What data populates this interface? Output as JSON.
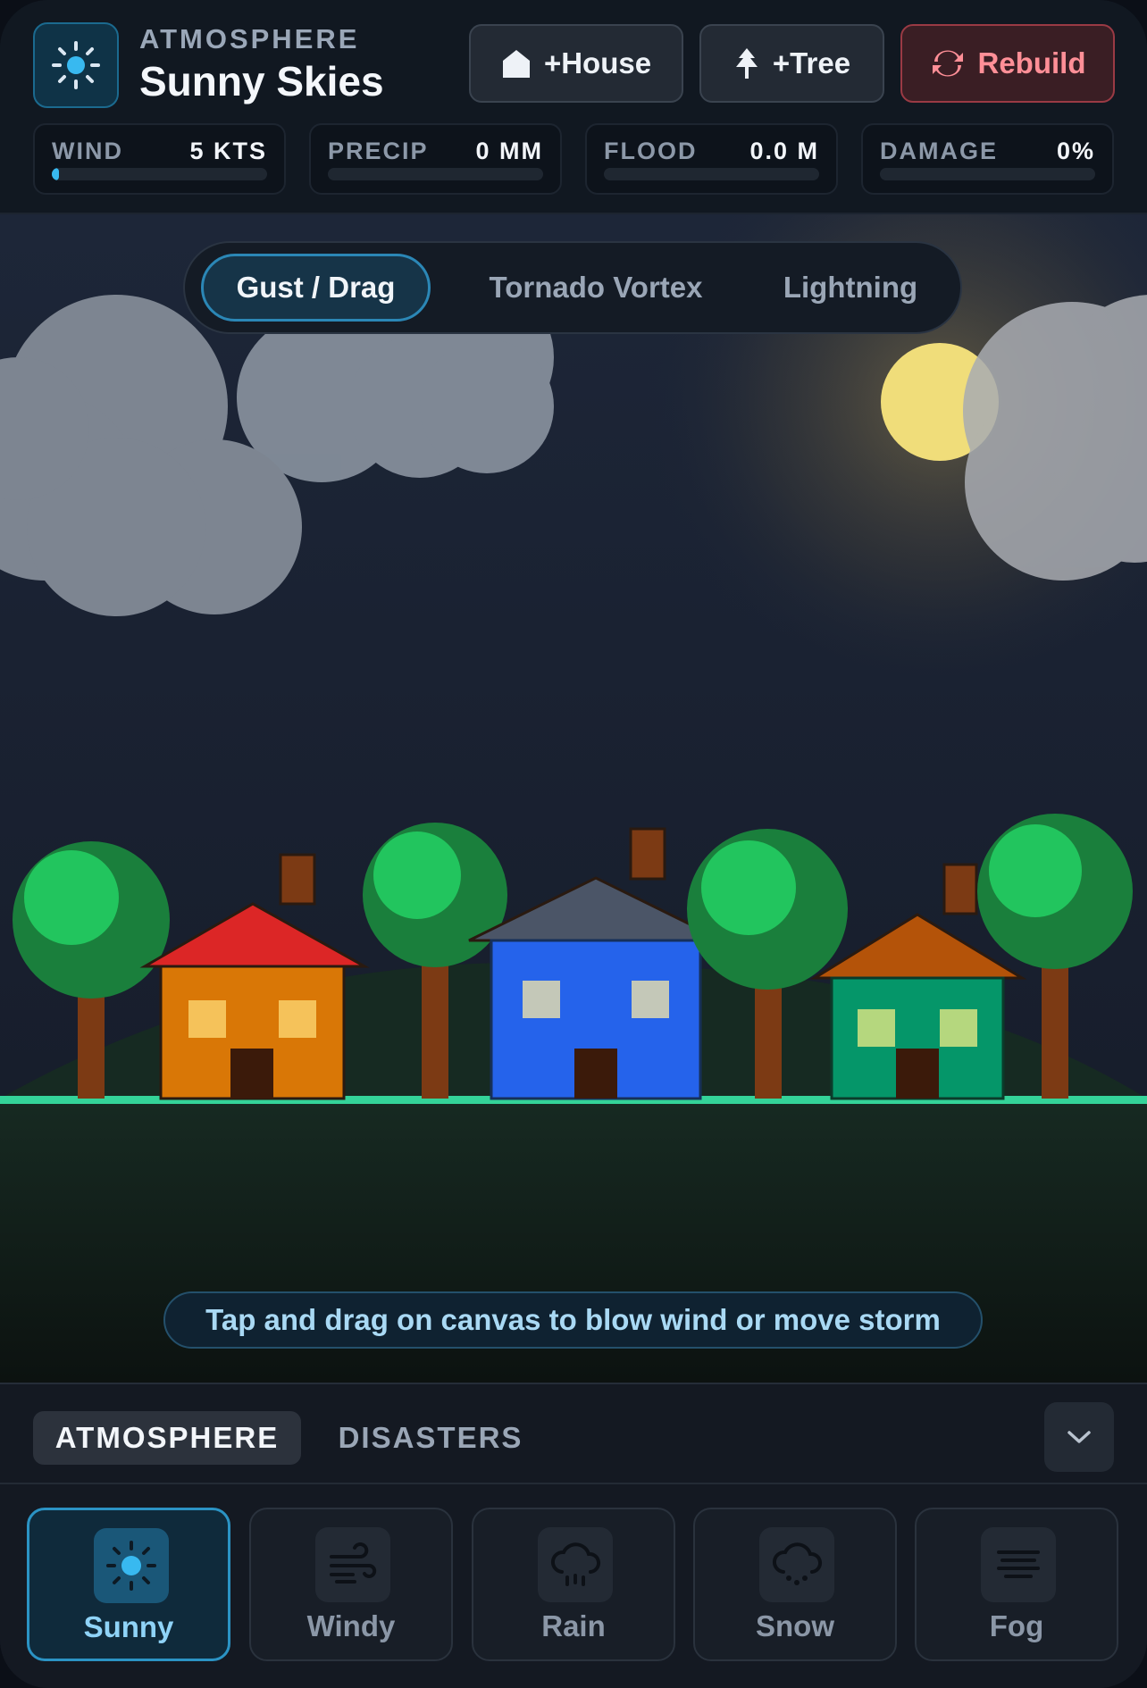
{
  "header": {
    "eyebrow": "ATMOSPHERE",
    "title": "Sunny Skies",
    "mode_icon": "sun-icon",
    "buttons": {
      "house": "+House",
      "tree": "+Tree",
      "rebuild": "Rebuild"
    }
  },
  "stats": [
    {
      "label": "WIND",
      "value": "5 KTS",
      "level": 0.03
    },
    {
      "label": "PRECIP",
      "value": "0 MM",
      "level": 0
    },
    {
      "label": "FLOOD",
      "value": "0.0 M",
      "level": 0
    },
    {
      "label": "DAMAGE",
      "value": "0%",
      "level": 0
    }
  ],
  "interaction_modes": {
    "items": [
      "Gust / Drag",
      "Tornado Vortex",
      "Lightning"
    ],
    "selected": "Gust / Drag"
  },
  "hint": "Tap and drag on canvas to blow wind or move storm",
  "panel": {
    "tabs": [
      "ATMOSPHERE",
      "DISASTERS"
    ],
    "active_tab": "ATMOSPHERE",
    "weather": [
      {
        "label": "Sunny",
        "icon": "sun-icon"
      },
      {
        "label": "Windy",
        "icon": "wind-icon"
      },
      {
        "label": "Rain",
        "icon": "rain-cloud-icon"
      },
      {
        "label": "Snow",
        "icon": "snow-cloud-icon"
      },
      {
        "label": "Fog",
        "icon": "fog-icon"
      }
    ],
    "selected_weather": "Sunny"
  },
  "colors": {
    "accent": "#38b9f0",
    "rebuild": "#ff8f97",
    "sky": "#1c2436",
    "grass_edge": "#34d399"
  }
}
